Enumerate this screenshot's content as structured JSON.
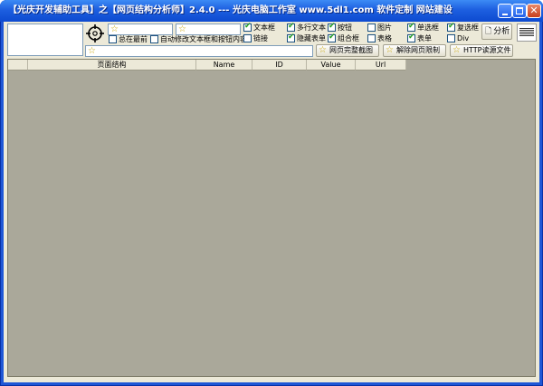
{
  "window": {
    "title": "【光庆开发辅助工具】之【网页结构分析师】2.4.0 --- 光庆电脑工作室  www.5dl1.com  软件定制 网站建设"
  },
  "toolbar": {
    "always_on_top_label": "总在最前",
    "auto_modify_label": "自动修改文本框和按钮内容",
    "analyze_label": "分析",
    "full_screenshot_label": "网页完整截图",
    "remove_limit_label": "解除网页限制",
    "http_read_label": "HTTP读源文件"
  },
  "filters": [
    {
      "label": "文本框",
      "checked": true
    },
    {
      "label": "多行文本",
      "checked": true
    },
    {
      "label": "按钮",
      "checked": true
    },
    {
      "label": "图片",
      "checked": false
    },
    {
      "label": "单选框",
      "checked": true
    },
    {
      "label": "复选框",
      "checked": true
    },
    {
      "label": "链接",
      "checked": false
    },
    {
      "label": "隐藏表单",
      "checked": true
    },
    {
      "label": "组合框",
      "checked": true
    },
    {
      "label": "表格",
      "checked": false
    },
    {
      "label": "表单",
      "checked": true
    },
    {
      "label": "Div",
      "checked": false
    }
  ],
  "grid": {
    "columns": [
      "",
      "页面结构",
      "Name",
      "ID",
      "Value",
      "Url"
    ]
  },
  "colors": {
    "titlebar": "#1d5fe0",
    "client": "#ece9d8",
    "grid_bg": "#aaa89a"
  }
}
